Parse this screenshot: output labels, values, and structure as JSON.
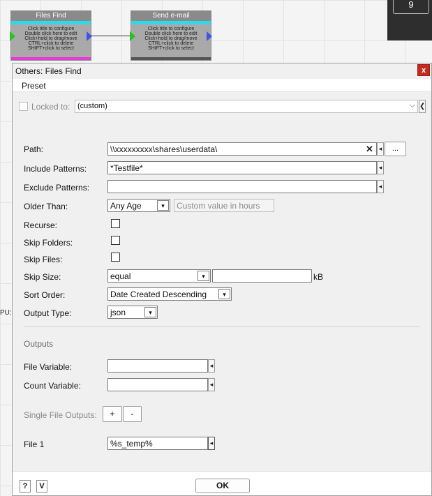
{
  "canvas": {
    "counter": "9",
    "side_label": "PU:",
    "nodes": [
      {
        "title": "Files Find",
        "lines": [
          "Click title to configure",
          "Double click here to edit",
          "Click+hold to drag/move",
          "CTRL+click to delete",
          "SHIFT+click to select"
        ]
      },
      {
        "title": "Send e-mail",
        "lines": [
          "Click title to configure",
          "Double click here to edit",
          "Click+hold to drag/move",
          "CTRL+click to delete",
          "SHIFT+click to select"
        ]
      }
    ],
    "colors": {
      "node_bar": "#2fd9e8",
      "port_in": "#22c322",
      "port_out": "#3a56e8",
      "node1_bottom": "#e23bd6",
      "node2_bottom": "#555555"
    }
  },
  "dialog": {
    "title": "Others: Files Find",
    "close_label": "x",
    "menu": {
      "preset": "Preset"
    },
    "locked": {
      "label": "Locked to:",
      "value": "(custom)",
      "chevron": "⌵",
      "arrow": "❮"
    },
    "fields": {
      "path": {
        "label": "Path:",
        "value": "\\\\xxxxxxxxx\\shares\\userdata\\",
        "clear": "✕",
        "browse": "..."
      },
      "include": {
        "label": "Include Patterns:",
        "value": "*Testfile*"
      },
      "exclude": {
        "label": "Exclude Patterns:",
        "value": ""
      },
      "older_than": {
        "label": "Older Than:",
        "value": "Any Age",
        "placeholder": "Custom value in hours"
      },
      "recurse": {
        "label": "Recurse:"
      },
      "skip_folders": {
        "label": "Skip Folders:"
      },
      "skip_files": {
        "label": "Skip Files:"
      },
      "skip_size": {
        "label": "Skip Size:",
        "value": "equal",
        "size_value": "",
        "unit": "kB"
      },
      "sort_order": {
        "label": "Sort Order:",
        "value": "Date Created Descending"
      },
      "output_type": {
        "label": "Output Type:",
        "value": "json"
      }
    },
    "outputs": {
      "heading": "Outputs",
      "file_variable": {
        "label": "File Variable:",
        "value": ""
      },
      "count_variable": {
        "label": "Count Variable:",
        "value": ""
      },
      "single_file": {
        "label": "Single File Outputs:",
        "add": "+",
        "remove": "-"
      },
      "file1": {
        "label": "File 1",
        "value": "%s_temp%"
      }
    },
    "mini_arrow": "◂",
    "dropdown_arrow": "▾",
    "footer": {
      "help": "?",
      "v": "V",
      "ok": "OK"
    }
  }
}
